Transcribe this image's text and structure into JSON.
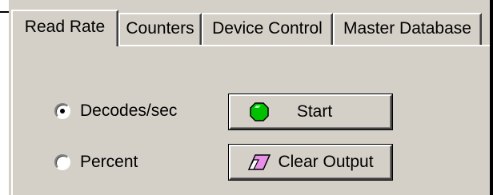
{
  "tabs": [
    {
      "label": "Read Rate",
      "active": true
    },
    {
      "label": "Counters",
      "active": false
    },
    {
      "label": "Device Control",
      "active": false
    },
    {
      "label": "Master Database",
      "active": false
    }
  ],
  "display_mode": {
    "options": [
      {
        "label": "Decodes/sec",
        "checked": true
      },
      {
        "label": "Percent",
        "checked": false
      }
    ]
  },
  "buttons": {
    "start_label": "Start",
    "start_icon": "green-octagon-icon",
    "start_icon_color": "#00c000",
    "clear_label": "Clear Output",
    "clear_icon": "eraser-icon",
    "clear_icon_color": "#e890e8"
  }
}
